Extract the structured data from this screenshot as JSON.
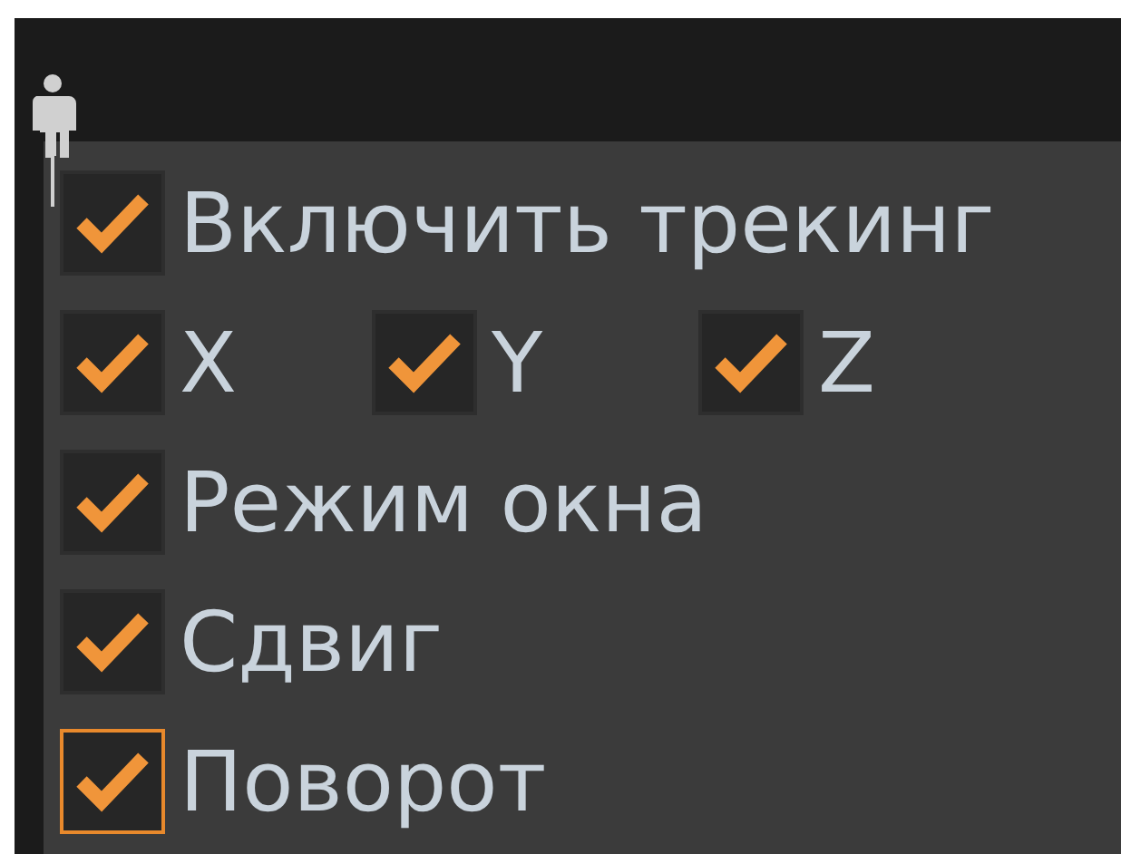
{
  "rows": [
    {
      "items": [
        {
          "label": "Включить трекинг",
          "checked": true,
          "focused": false
        }
      ]
    },
    {
      "items": [
        {
          "label": "X",
          "checked": true,
          "focused": false
        },
        {
          "label": "Y",
          "checked": true,
          "focused": false
        },
        {
          "label": "Z",
          "checked": true,
          "focused": false
        }
      ]
    },
    {
      "items": [
        {
          "label": "Режим окна",
          "checked": true,
          "focused": false
        }
      ]
    },
    {
      "items": [
        {
          "label": "Сдвиг",
          "checked": true,
          "focused": false
        }
      ]
    },
    {
      "items": [
        {
          "label": "Поворот",
          "checked": true,
          "focused": true
        }
      ]
    }
  ]
}
